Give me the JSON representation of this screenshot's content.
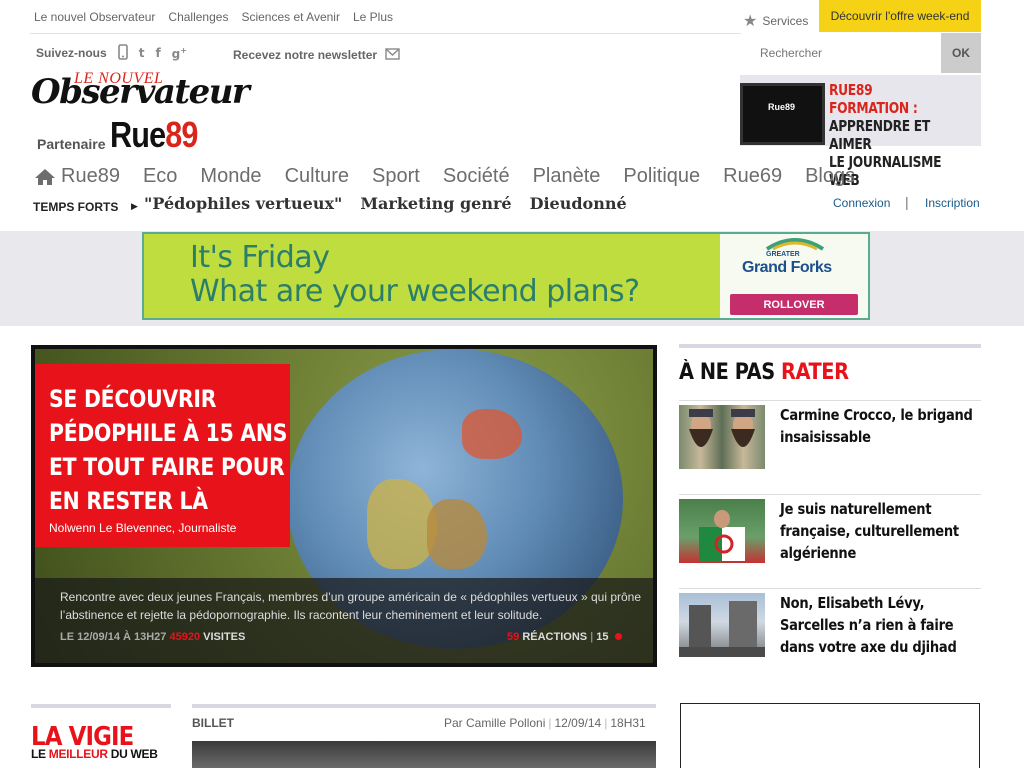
{
  "topnav": [
    "Le nouvel Observateur",
    "Challenges",
    "Sciences et Avenir",
    "Le Plus"
  ],
  "services_label": "Services",
  "offer_label": "Découvrir l'offre week-end",
  "follow_label": "Suivez-nous",
  "newsletter_label": "Recevez notre newsletter",
  "search": {
    "placeholder": "Rechercher",
    "button": "OK"
  },
  "logo": {
    "top": "LE NOUVEL",
    "main": "Observateur",
    "partner": "Partenaire",
    "rue": "Rue",
    "num": "89"
  },
  "formation_banner": {
    "line1": "RUE89 FORMATION :",
    "line2": "APPRENDRE ET AIMER",
    "line3": "LE JOURNALISME WEB",
    "screen": "Rue89"
  },
  "mainnav": [
    "Rue89",
    "Eco",
    "Monde",
    "Culture",
    "Sport",
    "Société",
    "Planète",
    "Politique",
    "Rue69",
    "Blogs"
  ],
  "temps_forts": {
    "label": "TEMPS FORTS",
    "links": [
      "\"Pédophiles vertueux\"",
      "Marketing genré",
      "Dieudonné"
    ]
  },
  "account": {
    "login": "Connexion",
    "separator": "|",
    "register": "Inscription"
  },
  "ad": {
    "line1": "It's Friday",
    "line2": "What are your weekend plans?",
    "brand_small": "GREATER",
    "brand": "Grand Forks",
    "cta": "ROLLOVER"
  },
  "hero": {
    "title": "SE DÉCOUVRIR PÉDOPHILE À 15 ANS ET TOUT FAIRE POUR EN RESTER LÀ",
    "author": "Nolwenn Le Blevennec, Journaliste",
    "description": "Rencontre avec deux jeunes Français, membres d’un groupe américain de « pédophiles vertueux » qui prône l’abstinence et rejette la pédopornographie. Ils racontent leur cheminement et leur solitude.",
    "date": "LE 12/09/14 À 13H27",
    "visits": "45920",
    "visits_label": "VISITES",
    "reactions": "59",
    "reactions_label": "RÉACTIONS",
    "extra_count": "15"
  },
  "ne_pas_rater": {
    "title_a": "À NE PAS ",
    "title_b": "RATER",
    "items": [
      {
        "title": "Carmine Crocco, le brigand insaisissable"
      },
      {
        "title": "Je suis naturellement française, culturellement algérienne"
      },
      {
        "title": "Non, Elisabeth Lévy, Sarcelles n’a rien à faire dans votre axe du djihad"
      }
    ]
  },
  "vigie": {
    "title": "LA VIGIE",
    "sub_a": "LE ",
    "sub_b": "MEILLEUR",
    "sub_c": " DU WEB"
  },
  "billet": {
    "label": "BILLET",
    "author": "Par Camille Polloni",
    "date": "12/09/14",
    "time": "18H31",
    "sep": "|"
  },
  "colors": {
    "accent_red": "#e8131a",
    "offer_yellow": "#f5d216",
    "link_blue": "#1a5a8a"
  }
}
